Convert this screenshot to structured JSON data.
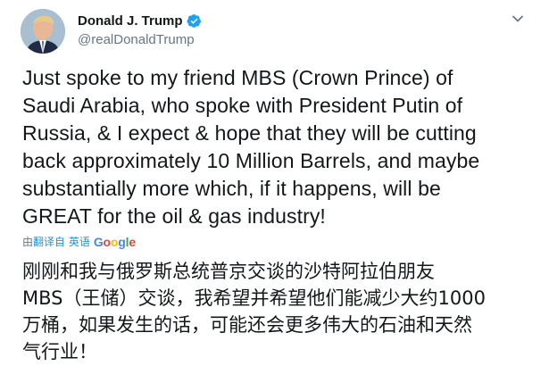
{
  "author": {
    "display_name": "Donald J. Trump",
    "handle": "@realDonaldTrump",
    "verified": true
  },
  "tweet": {
    "lines": [
      "Just spoke to my friend MBS (Crown Prince) of",
      "Saudi Arabia, who spoke with President Putin of",
      "Russia, & I expect & hope that they will be cutting",
      "back approximately 10 Million Barrels, and maybe",
      "substantially more which, if it happens, will be",
      "GREAT for the oil & gas industry!"
    ]
  },
  "translation": {
    "prefix": "由",
    "link_text": "翻译自 英语",
    "google_letters": [
      "G",
      "o",
      "o",
      "g",
      "l",
      "e"
    ],
    "lines": [
      "刚刚和我与俄罗斯总统普京交谈的沙特阿拉伯朋友",
      "MBS（王储）交谈，我希望并希望他们能减少大约1000",
      "万桶，如果发生的话，可能还会更多伟大的石油和天然",
      "气行业！"
    ]
  },
  "colors": {
    "verified_badge": "#1da1f2",
    "link": "#1b95e0",
    "secondary_text": "#657786"
  },
  "icons": {
    "verified": "verified-badge-icon",
    "more": "chevron-down-icon"
  }
}
